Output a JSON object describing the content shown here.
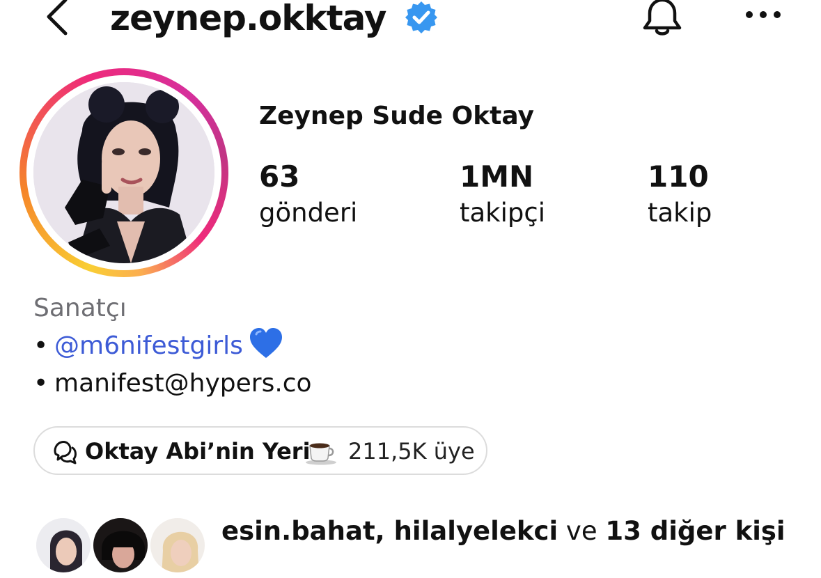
{
  "header": {
    "username": "zeynep.okktay",
    "back_icon": "chevron-left-icon",
    "verified_icon": "verified-badge-icon",
    "bell_icon": "bell-icon",
    "more_icon": "more-horizontal-icon",
    "verified_color": "#3897f0"
  },
  "profile": {
    "full_name": "Zeynep Sude Oktay",
    "stats": [
      {
        "value": "63",
        "label": "gönderi"
      },
      {
        "value": "1MN",
        "label": "takipçi"
      },
      {
        "value": "110",
        "label": "takip"
      }
    ]
  },
  "bio": {
    "category": "Sanatçı",
    "bullet": "•",
    "mention": "@m6nifestgirls",
    "mention_emoji": "blue-heart-icon",
    "email": "manifest@hypers.co",
    "mention_color": "#3d5bd6"
  },
  "channel": {
    "icon": "broadcast-channel-icon",
    "name": "Oktay Abi’nin Yeri",
    "emoji": "coffee-icon",
    "members": "211,5K üye"
  },
  "followed_by": {
    "names": "esin.bahat, hilalyelekci",
    "connector": " ve ",
    "others": "13 diğer kişi"
  }
}
